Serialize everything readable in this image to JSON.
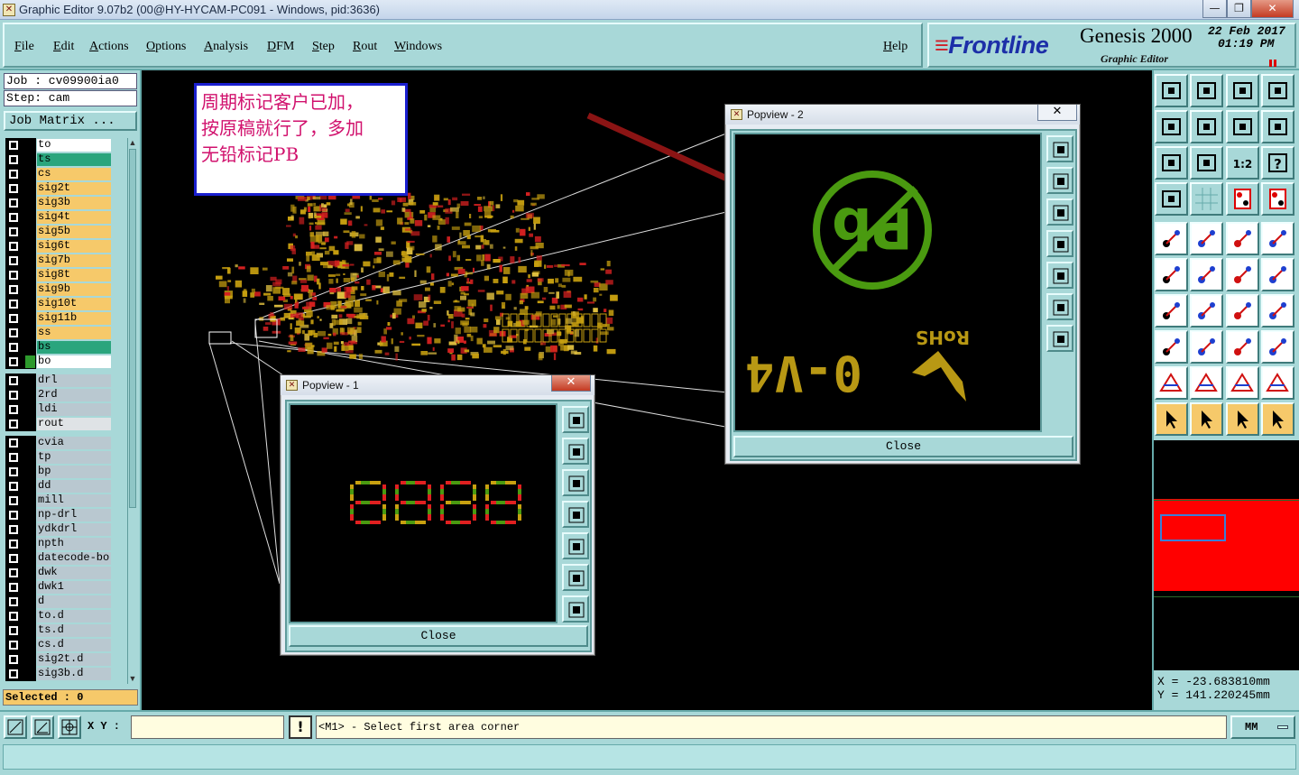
{
  "window": {
    "title": "Graphic Editor 9.07b2 (00@HY-HYCAM-PC091 - Windows, pid:3636)",
    "minimize": "—",
    "maximize": "❐",
    "close": "✕"
  },
  "menu": {
    "items": [
      "File",
      "Edit",
      "Actions",
      "Options",
      "Analysis",
      "DFM",
      "Step",
      "Rout",
      "Windows"
    ],
    "help": "Help"
  },
  "brand": {
    "logo": "Frontline",
    "product": "Genesis 2000",
    "subtitle": "Graphic Editor",
    "date": "22 Feb 2017",
    "time": "01:19 PM"
  },
  "job": {
    "job_line": "Job : cv09900ia0",
    "step_line": "Step: cam",
    "matrix_button": "Job Matrix ..."
  },
  "layers": {
    "group1": [
      {
        "name": "to",
        "color": "#ffffff"
      },
      {
        "name": "ts",
        "color": "#2aa57d"
      },
      {
        "name": "cs",
        "color": "#f6c96a"
      },
      {
        "name": "sig2t",
        "color": "#f6c96a"
      },
      {
        "name": "sig3b",
        "color": "#f6c96a"
      },
      {
        "name": "sig4t",
        "color": "#f6c96a"
      },
      {
        "name": "sig5b",
        "color": "#f6c96a"
      },
      {
        "name": "sig6t",
        "color": "#f6c96a"
      },
      {
        "name": "sig7b",
        "color": "#f6c96a"
      },
      {
        "name": "sig8t",
        "color": "#f6c96a"
      },
      {
        "name": "sig9b",
        "color": "#f6c96a"
      },
      {
        "name": "sig10t",
        "color": "#f6c96a"
      },
      {
        "name": "sig11b",
        "color": "#f6c96a"
      },
      {
        "name": "ss",
        "color": "#f6c96a"
      },
      {
        "name": "bs",
        "color": "#2aa57d"
      },
      {
        "name": "bo",
        "color": "#ffffff",
        "swatch": "#2d9a2d"
      }
    ],
    "group2": [
      {
        "name": "drl",
        "color": "#b9c8d0"
      },
      {
        "name": "2rd",
        "color": "#b9c8d0"
      },
      {
        "name": "ldi",
        "color": "#b9c8d0"
      },
      {
        "name": "rout",
        "color": "#dfe3e6"
      }
    ],
    "group3": [
      {
        "name": "cvia",
        "color": "#b9c8d0"
      },
      {
        "name": "tp",
        "color": "#b9c8d0"
      },
      {
        "name": "bp",
        "color": "#b9c8d0"
      },
      {
        "name": "dd",
        "color": "#b9c8d0"
      },
      {
        "name": "mill",
        "color": "#b9c8d0"
      },
      {
        "name": "np-drl",
        "color": "#b9c8d0"
      },
      {
        "name": "ydkdrl",
        "color": "#b9c8d0"
      },
      {
        "name": "npth",
        "color": "#b9c8d0"
      },
      {
        "name": "datecode-bo",
        "color": "#b9c8d0"
      },
      {
        "name": "dwk",
        "color": "#b9c8d0"
      },
      {
        "name": "dwk1",
        "color": "#b9c8d0"
      },
      {
        "name": "d",
        "color": "#b9c8d0"
      },
      {
        "name": "to.d",
        "color": "#b9c8d0"
      },
      {
        "name": "ts.d",
        "color": "#b9c8d0"
      },
      {
        "name": "cs.d",
        "color": "#b9c8d0"
      },
      {
        "name": "sig2t.d",
        "color": "#b9c8d0"
      },
      {
        "name": "sig3b.d",
        "color": "#b9c8d0"
      }
    ],
    "selected": "Selected : 0"
  },
  "note": {
    "lines": [
      "周期标记客户已加，",
      "按原稿就行了，多加",
      "无铅标记PB"
    ]
  },
  "popup1": {
    "title": "Popview - 1",
    "close_label": "Close"
  },
  "popup2": {
    "title": "Popview - 2",
    "close_label": "Close",
    "marking_text": "0-V4",
    "rohs_text": "RoHS",
    "pb_text": "Pb"
  },
  "coords": {
    "x": "X = -23.683810mm",
    "y": "Y = 141.220245mm"
  },
  "bottom": {
    "xy_label": "X Y :",
    "xy_value": "",
    "exclaim": "!",
    "prompt": "<M1> - Select first area corner",
    "units": "MM"
  },
  "colors": {
    "panel": "#a8d8d8",
    "layer_active": "#f6c96a",
    "layer_teal": "#2aa57d",
    "board_red": "#ff0000",
    "note_text": "#d1116d",
    "note_border": "#1a1fcf",
    "marking_green": "#4a9a10",
    "marking_gold": "#b89814"
  }
}
